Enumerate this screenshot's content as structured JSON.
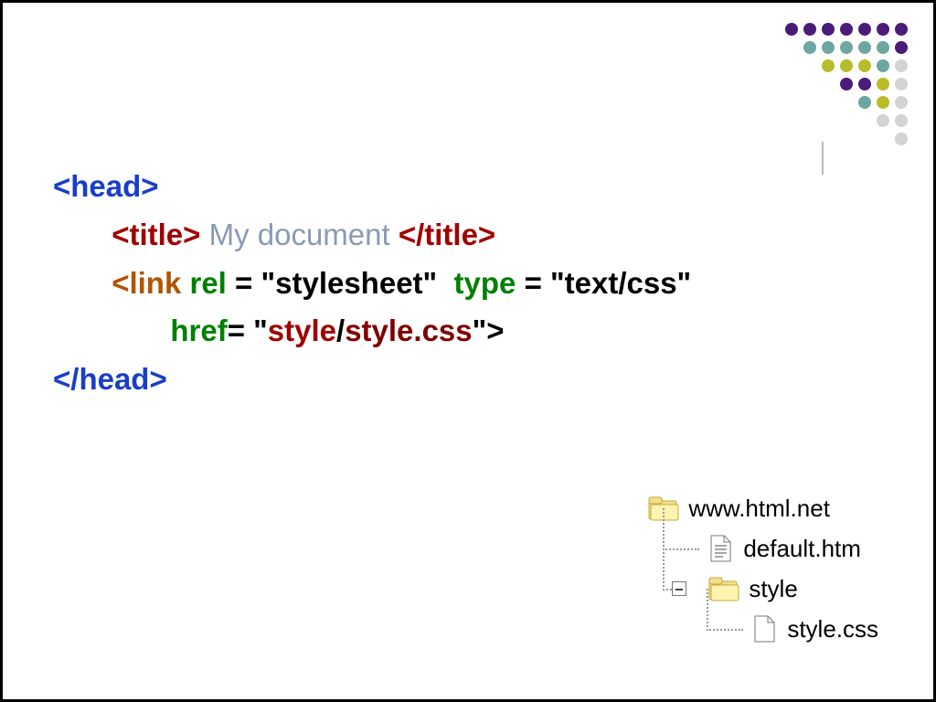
{
  "decor": {
    "rows": [
      [
        "#4b1b7a",
        "#4b1b7a",
        "#4b1b7a",
        "#4b1b7a",
        "#4b1b7a",
        "#4b1b7a",
        "#4b1b7a"
      ],
      [
        null,
        "#6ea6a0",
        "#6ea6a0",
        "#6ea6a0",
        "#6ea6a0",
        "#6ea6a0",
        "#4b1b7a"
      ],
      [
        null,
        null,
        "#b8bc2a",
        "#b8bc2a",
        "#b8bc2a",
        "#6ea6a0",
        "#d3d3d3"
      ],
      [
        null,
        null,
        null,
        "#4b1b7a",
        "#4b1b7a",
        "#b8bc2a",
        "#d3d3d3"
      ],
      [
        null,
        null,
        null,
        null,
        "#6ea6a0",
        "#b8bc2a",
        "#d3d3d3"
      ],
      [
        null,
        null,
        null,
        null,
        null,
        "#d3d3d3",
        "#d3d3d3"
      ],
      [
        null,
        null,
        null,
        null,
        null,
        null,
        "#d3d3d3"
      ]
    ]
  },
  "code": {
    "l1": {
      "a": "<head>"
    },
    "l2": {
      "a": "<title>",
      "b": " My document ",
      "c": "</title>"
    },
    "l3": {
      "a": "<link ",
      "b": "rel ",
      "c": "= \"stylesheet\"  ",
      "d": "type ",
      "e": "= \"text/css\""
    },
    "l4": {
      "a": "href",
      "b": "= \"",
      "c": "style",
      "d": "/",
      "e": "style.css",
      "f": "\">"
    },
    "l5": {
      "a": "</head>"
    }
  },
  "tree": {
    "root": "www.html.net",
    "file1": "default.htm",
    "folder": "style",
    "file2": "style.css"
  }
}
